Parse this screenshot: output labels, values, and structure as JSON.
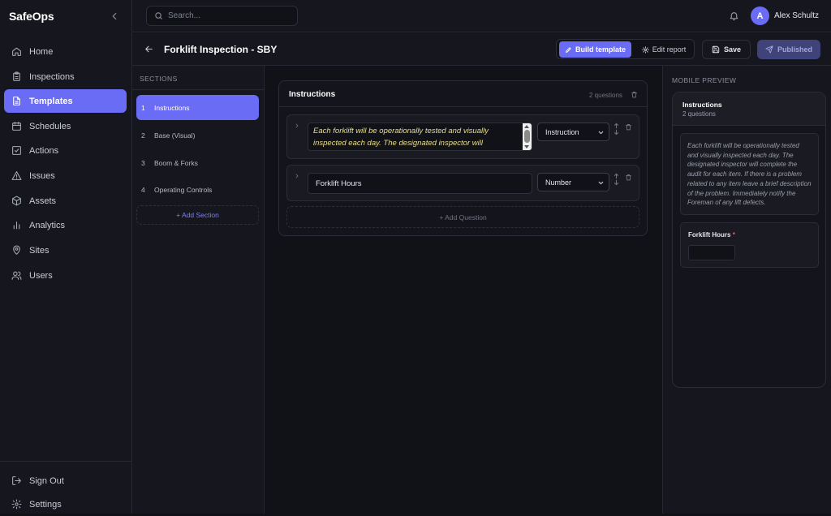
{
  "app": {
    "name": "SafeOps"
  },
  "sidebar": {
    "items": [
      {
        "label": "Home",
        "icon": "home-icon"
      },
      {
        "label": "Inspections",
        "icon": "clipboard-icon"
      },
      {
        "label": "Templates",
        "icon": "document-icon",
        "active": true
      },
      {
        "label": "Schedules",
        "icon": "calendar-icon"
      },
      {
        "label": "Actions",
        "icon": "check-square-icon"
      },
      {
        "label": "Issues",
        "icon": "warning-icon"
      },
      {
        "label": "Assets",
        "icon": "box-icon"
      },
      {
        "label": "Analytics",
        "icon": "bar-chart-icon"
      },
      {
        "label": "Sites",
        "icon": "map-pin-icon"
      },
      {
        "label": "Users",
        "icon": "users-icon"
      }
    ],
    "footer": [
      {
        "label": "Sign Out",
        "icon": "logout-icon"
      },
      {
        "label": "Settings",
        "icon": "gear-icon"
      }
    ]
  },
  "topbar": {
    "search_placeholder": "Search...",
    "user": {
      "initial": "A",
      "name": "Alex Schultz"
    }
  },
  "header": {
    "title": "Forklift Inspection - SBY",
    "build_label": "Build template",
    "edit_label": "Edit report",
    "save_label": "Save",
    "published_label": "Published"
  },
  "sections": {
    "heading": "SECTIONS",
    "items": [
      {
        "num": "1",
        "label": "Instructions",
        "active": true
      },
      {
        "num": "2",
        "label": "Base (Visual)"
      },
      {
        "num": "3",
        "label": "Boom & Forks"
      },
      {
        "num": "4",
        "label": "Operating Controls"
      }
    ],
    "add_label": "+ Add Section"
  },
  "editor": {
    "section_title": "Instructions",
    "question_count": "2 questions",
    "questions": [
      {
        "text": "Each forklift will be operationally tested and visually inspected each day. The designated inspector will",
        "type": "Instruction"
      },
      {
        "text": "Forklift Hours",
        "type": "Number"
      }
    ],
    "add_question_label": "+ Add Question"
  },
  "preview": {
    "heading": "MOBILE PREVIEW",
    "section_title": "Instructions",
    "section_meta": "2 questions",
    "instruction_text": "Each forklift will be operationally tested and visually inspected each day. The designated inspector will complete the audit for each item. If there is a problem related to any item leave a brief description of the problem. Immediately notify the Foreman of any lift defects.",
    "question_label": "Forklift Hours",
    "required_mark": "*"
  },
  "colors": {
    "accent": "#6b6cf5",
    "background": "#111218",
    "panel": "#16171e",
    "instruction_text": "#eadf8a",
    "required": "#f0556a"
  }
}
